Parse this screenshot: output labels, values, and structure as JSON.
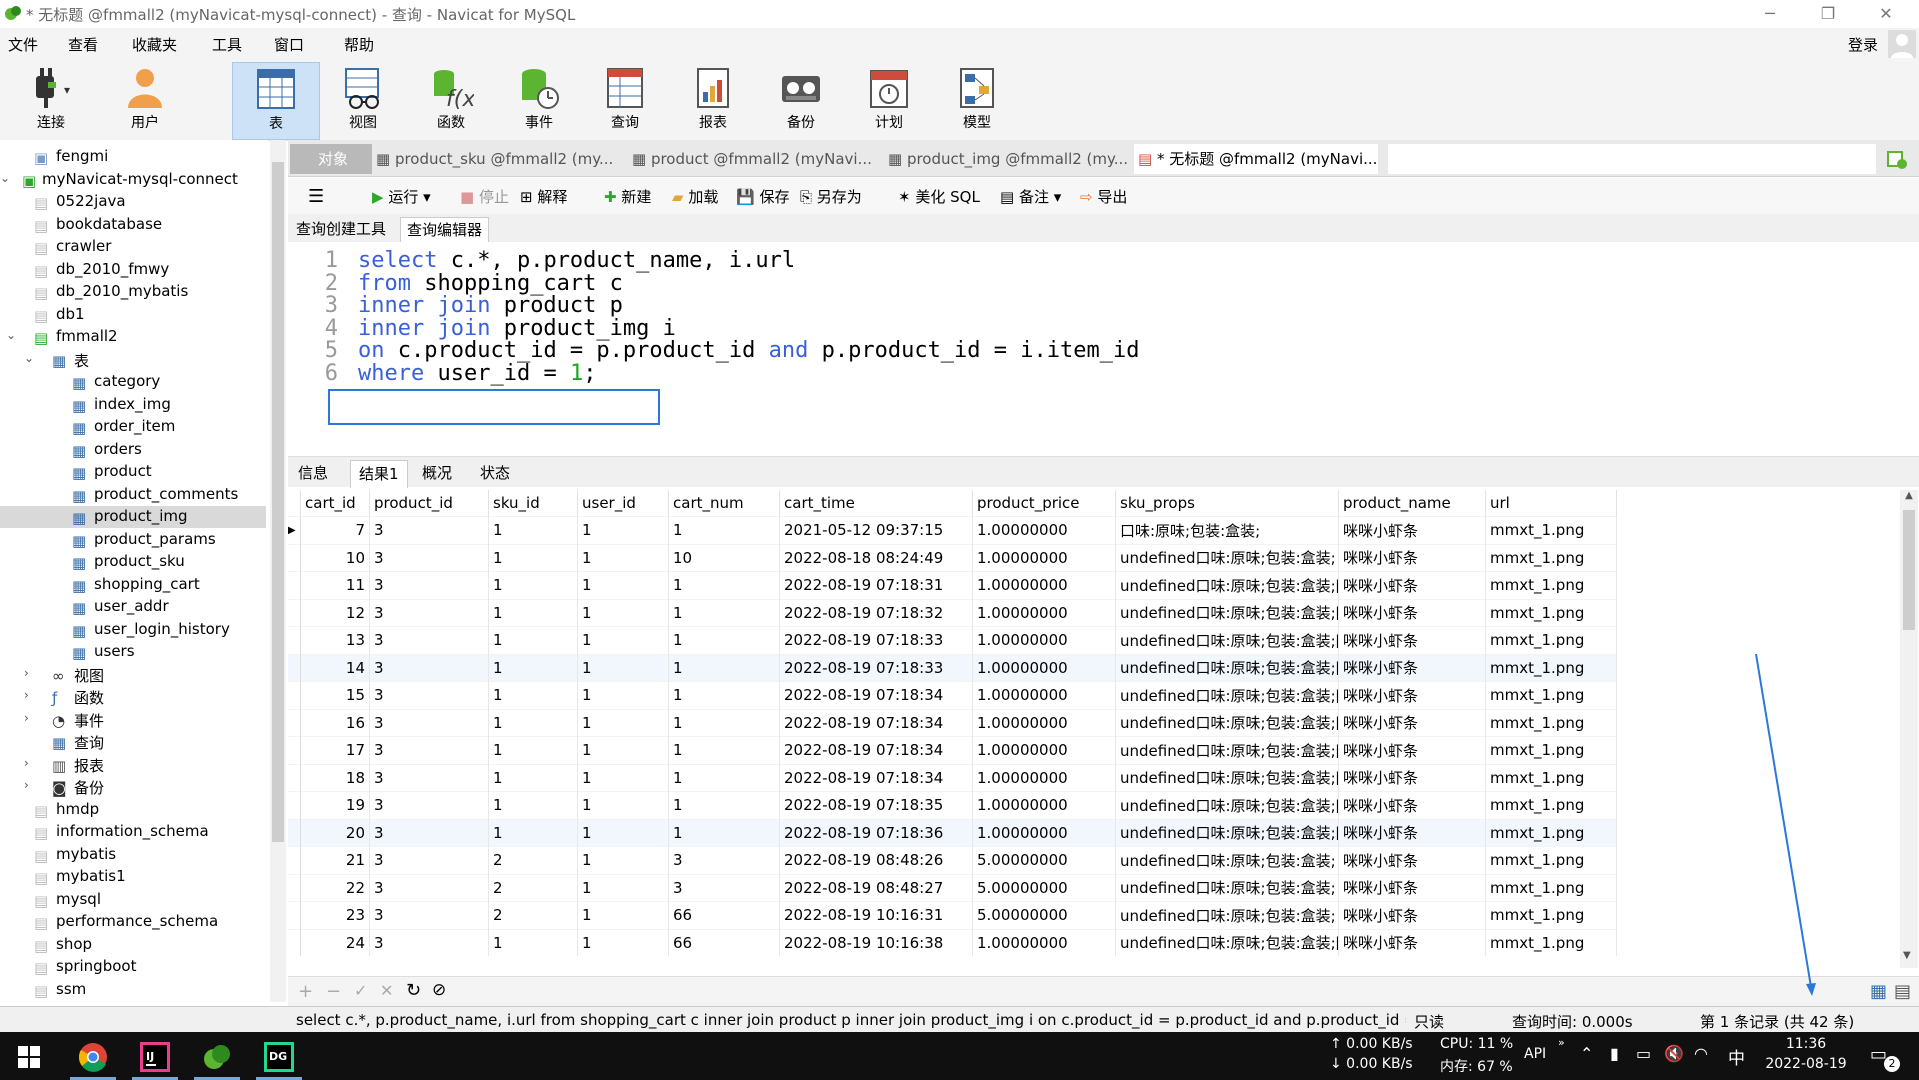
{
  "window": {
    "title": "* 无标题 @fmmall2 (myNavicat-mysql-connect) - 查询 - Navicat for MySQL",
    "login_label": "登录"
  },
  "menu": [
    "文件",
    "查看",
    "收藏夹",
    "工具",
    "窗口",
    "帮助"
  ],
  "toolbar": [
    {
      "label": "连接",
      "icon": "plug-icon"
    },
    {
      "label": "用户",
      "icon": "user-icon"
    },
    {
      "label": "表",
      "icon": "table-icon",
      "active": true
    },
    {
      "label": "视图",
      "icon": "view-icon"
    },
    {
      "label": "函数",
      "icon": "function-icon"
    },
    {
      "label": "事件",
      "icon": "event-icon"
    },
    {
      "label": "查询",
      "icon": "query-icon"
    },
    {
      "label": "报表",
      "icon": "report-icon"
    },
    {
      "label": "备份",
      "icon": "backup-icon"
    },
    {
      "label": "计划",
      "icon": "calendar-icon"
    },
    {
      "label": "模型",
      "icon": "model-icon"
    }
  ],
  "tree": [
    {
      "label": "fengmi",
      "level": 1,
      "icon": "connection-icon"
    },
    {
      "label": "myNavicat-mysql-connect",
      "level": 0,
      "icon": "connection-green-icon",
      "expanded": true
    },
    {
      "label": "0522java",
      "level": 1,
      "icon": "database-icon"
    },
    {
      "label": "bookdatabase",
      "level": 1,
      "icon": "database-icon"
    },
    {
      "label": "crawler",
      "level": 1,
      "icon": "database-icon"
    },
    {
      "label": "db_2010_fmwy",
      "level": 1,
      "icon": "database-icon"
    },
    {
      "label": "db_2010_mybatis",
      "level": 1,
      "icon": "database-icon"
    },
    {
      "label": "db1",
      "level": 1,
      "icon": "database-icon"
    },
    {
      "label": "fmmall2",
      "level": 1,
      "icon": "database-green-icon",
      "expanded": true
    },
    {
      "label": "表",
      "level": 2,
      "icon": "table-icon",
      "expanded": true
    },
    {
      "label": "category",
      "level": 3,
      "icon": "table-icon"
    },
    {
      "label": "index_img",
      "level": 3,
      "icon": "table-icon"
    },
    {
      "label": "order_item",
      "level": 3,
      "icon": "table-icon"
    },
    {
      "label": "orders",
      "level": 3,
      "icon": "table-icon"
    },
    {
      "label": "product",
      "level": 3,
      "icon": "table-icon"
    },
    {
      "label": "product_comments",
      "level": 3,
      "icon": "table-icon"
    },
    {
      "label": "product_img",
      "level": 3,
      "icon": "table-icon",
      "selected": true
    },
    {
      "label": "product_params",
      "level": 3,
      "icon": "table-icon"
    },
    {
      "label": "product_sku",
      "level": 3,
      "icon": "table-icon"
    },
    {
      "label": "shopping_cart",
      "level": 3,
      "icon": "table-icon"
    },
    {
      "label": "user_addr",
      "level": 3,
      "icon": "table-icon"
    },
    {
      "label": "user_login_history",
      "level": 3,
      "icon": "table-icon"
    },
    {
      "label": "users",
      "level": 3,
      "icon": "table-icon"
    },
    {
      "label": "视图",
      "level": 2,
      "icon": "view-icon",
      "collapsed": true
    },
    {
      "label": "函数",
      "level": 2,
      "icon": "function-icon",
      "collapsed": true
    },
    {
      "label": "事件",
      "level": 2,
      "icon": "event-icon",
      "collapsed": true
    },
    {
      "label": "查询",
      "level": 2,
      "icon": "query-icon"
    },
    {
      "label": "报表",
      "level": 2,
      "icon": "report-icon",
      "collapsed": true
    },
    {
      "label": "备份",
      "level": 2,
      "icon": "backup-icon",
      "collapsed": true
    },
    {
      "label": "hmdp",
      "level": 1,
      "icon": "database-icon"
    },
    {
      "label": "information_schema",
      "level": 1,
      "icon": "database-icon"
    },
    {
      "label": "mybatis",
      "level": 1,
      "icon": "database-icon"
    },
    {
      "label": "mybatis1",
      "level": 1,
      "icon": "database-icon"
    },
    {
      "label": "mysql",
      "level": 1,
      "icon": "database-icon"
    },
    {
      "label": "performance_schema",
      "level": 1,
      "icon": "database-icon"
    },
    {
      "label": "shop",
      "level": 1,
      "icon": "database-icon"
    },
    {
      "label": "springboot",
      "level": 1,
      "icon": "database-icon"
    },
    {
      "label": "ssm",
      "level": 1,
      "icon": "database-icon"
    }
  ],
  "doc_tabs": [
    {
      "label": "对象",
      "type": "object"
    },
    {
      "label": "product_sku @fmmall2 (my...",
      "type": "table"
    },
    {
      "label": "product @fmmall2 (myNavi...",
      "type": "table"
    },
    {
      "label": "product_img @fmmall2 (my...",
      "type": "table"
    },
    {
      "label": "* 无标题 @fmmall2 (myNavi...",
      "type": "query",
      "active": true
    }
  ],
  "query_toolbar": {
    "menu_icon": "hamburger-icon",
    "run": "运行",
    "stop": "停止",
    "explain": "解释",
    "new": "新建",
    "load": "加载",
    "save": "保存",
    "save_as": "另存为",
    "beautify": "美化 SQL",
    "comment": "备注",
    "export": "导出"
  },
  "editor_tabs": [
    "查询创建工具",
    "查询编辑器"
  ],
  "sql_lines": [
    {
      "n": "1",
      "parts": [
        [
          "kw",
          "select"
        ],
        [
          "",
          " c.*, p.product_name, i.url"
        ]
      ]
    },
    {
      "n": "2",
      "parts": [
        [
          "kw",
          "from"
        ],
        [
          "",
          " shopping_cart c"
        ]
      ]
    },
    {
      "n": "3",
      "parts": [
        [
          "kw",
          "inner join"
        ],
        [
          "",
          " product p"
        ]
      ]
    },
    {
      "n": "4",
      "parts": [
        [
          "kw",
          "inner join"
        ],
        [
          "",
          " product_img i"
        ]
      ]
    },
    {
      "n": "5",
      "parts": [
        [
          "kw",
          "on"
        ],
        [
          "",
          " c.product_id = p.product_id "
        ],
        [
          "kw",
          "and"
        ],
        [
          "",
          " p.product_id = i.item_id"
        ]
      ]
    },
    {
      "n": "6",
      "parts": [
        [
          "kw",
          "where"
        ],
        [
          "",
          " user_id = "
        ],
        [
          "num",
          "1"
        ],
        [
          "",
          ";"
        ]
      ]
    }
  ],
  "result_tabs": [
    "信息",
    "结果1",
    "概况",
    "状态"
  ],
  "grid": {
    "columns": [
      "cart_id",
      "product_id",
      "sku_id",
      "user_id",
      "cart_num",
      "cart_time",
      "product_price",
      "sku_props",
      "product_name",
      "url"
    ],
    "rows": [
      [
        "7",
        "3",
        "1",
        "1",
        "1",
        "2021-05-12 09:37:15",
        "1.00000000",
        "口味:原味;包装:盒装;",
        "咪咪小虾条",
        "mmxt_1.png"
      ],
      [
        "10",
        "3",
        "1",
        "1",
        "10",
        "2022-08-18 08:24:49",
        "1.00000000",
        "undefined口味:原味;包装:盒装;",
        "咪咪小虾条",
        "mmxt_1.png"
      ],
      [
        "11",
        "3",
        "1",
        "1",
        "1",
        "2022-08-19 07:18:31",
        "1.00000000",
        "undefined口味:原味;包装:盒装;[",
        "咪咪小虾条",
        "mmxt_1.png"
      ],
      [
        "12",
        "3",
        "1",
        "1",
        "1",
        "2022-08-19 07:18:32",
        "1.00000000",
        "undefined口味:原味;包装:盒装;[",
        "咪咪小虾条",
        "mmxt_1.png"
      ],
      [
        "13",
        "3",
        "1",
        "1",
        "1",
        "2022-08-19 07:18:33",
        "1.00000000",
        "undefined口味:原味;包装:盒装;[",
        "咪咪小虾条",
        "mmxt_1.png"
      ],
      [
        "14",
        "3",
        "1",
        "1",
        "1",
        "2022-08-19 07:18:33",
        "1.00000000",
        "undefined口味:原味;包装:盒装;[",
        "咪咪小虾条",
        "mmxt_1.png"
      ],
      [
        "15",
        "3",
        "1",
        "1",
        "1",
        "2022-08-19 07:18:34",
        "1.00000000",
        "undefined口味:原味;包装:盒装;[",
        "咪咪小虾条",
        "mmxt_1.png"
      ],
      [
        "16",
        "3",
        "1",
        "1",
        "1",
        "2022-08-19 07:18:34",
        "1.00000000",
        "undefined口味:原味;包装:盒装;[",
        "咪咪小虾条",
        "mmxt_1.png"
      ],
      [
        "17",
        "3",
        "1",
        "1",
        "1",
        "2022-08-19 07:18:34",
        "1.00000000",
        "undefined口味:原味;包装:盒装;[",
        "咪咪小虾条",
        "mmxt_1.png"
      ],
      [
        "18",
        "3",
        "1",
        "1",
        "1",
        "2022-08-19 07:18:34",
        "1.00000000",
        "undefined口味:原味;包装:盒装;[",
        "咪咪小虾条",
        "mmxt_1.png"
      ],
      [
        "19",
        "3",
        "1",
        "1",
        "1",
        "2022-08-19 07:18:35",
        "1.00000000",
        "undefined口味:原味;包装:盒装;[",
        "咪咪小虾条",
        "mmxt_1.png"
      ],
      [
        "20",
        "3",
        "1",
        "1",
        "1",
        "2022-08-19 07:18:36",
        "1.00000000",
        "undefined口味:原味;包装:盒装;[",
        "咪咪小虾条",
        "mmxt_1.png"
      ],
      [
        "21",
        "3",
        "2",
        "1",
        "3",
        "2022-08-19 08:48:26",
        "5.00000000",
        "undefined口味:原味;包装:盒装;",
        "咪咪小虾条",
        "mmxt_1.png"
      ],
      [
        "22",
        "3",
        "2",
        "1",
        "3",
        "2022-08-19 08:48:27",
        "5.00000000",
        "undefined口味:原味;包装:盒装;",
        "咪咪小虾条",
        "mmxt_1.png"
      ],
      [
        "23",
        "3",
        "2",
        "1",
        "66",
        "2022-08-19 10:16:31",
        "5.00000000",
        "undefined口味:原味;包装:盒装;",
        "咪咪小虾条",
        "mmxt_1.png"
      ],
      [
        "24",
        "3",
        "1",
        "1",
        "66",
        "2022-08-19 10:16:38",
        "1.00000000",
        "undefined口味:原味;包装:盒装;[",
        "咪咪小虾条",
        "mmxt_1.png"
      ]
    ]
  },
  "status": {
    "sql": "select c.*, p.product_name, i.url from shopping_cart c inner join product p inner join product_img i on c.product_id = p.product_id and p.product_id = i.i",
    "readonly": "只读",
    "query_time": "查询时间: 0.000s",
    "records": "第 1 条记录 (共 42 条)"
  },
  "taskbar": {
    "net_up": "↑ 0.00 KB/s",
    "net_down": "↓ 0.00 KB/s",
    "cpu": "CPU: 11 %",
    "mem": "内存: 67 %",
    "api": "API",
    "ime": "中",
    "time": "11:36",
    "date": "2022-08-19",
    "notif_count": "2"
  },
  "colors": {
    "keyword": "#3a5fdb",
    "number": "#19a819",
    "selection": "#cde2f7",
    "cursor_box": "#2a78d8"
  }
}
